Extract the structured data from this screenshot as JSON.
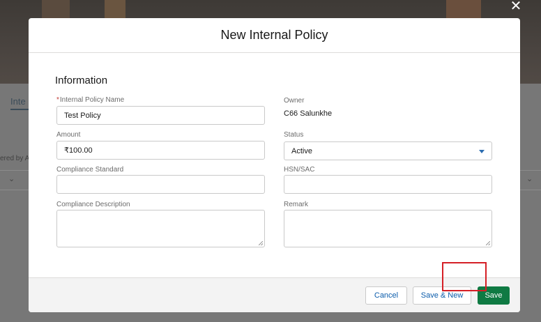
{
  "background": {
    "tab_label": "Inte",
    "filter_text": "ered by A"
  },
  "modal": {
    "title": "New Internal Policy",
    "close_icon": "close-icon",
    "section_title": "Information",
    "fields": {
      "policy_name": {
        "label": "Internal Policy Name",
        "required_marker": "*",
        "value": "Test Policy"
      },
      "owner": {
        "label": "Owner",
        "value": "C66 Salunkhe"
      },
      "amount": {
        "label": "Amount",
        "value": "₹100.00"
      },
      "status": {
        "label": "Status",
        "value": "Active"
      },
      "compliance_standard": {
        "label": "Compliance Standard",
        "value": ""
      },
      "hsn_sac": {
        "label": "HSN/SAC",
        "value": ""
      },
      "compliance_description": {
        "label": "Compliance Description",
        "value": ""
      },
      "remark": {
        "label": "Remark",
        "value": ""
      }
    },
    "footer": {
      "cancel_label": "Cancel",
      "save_new_label": "Save & New",
      "save_label": "Save"
    }
  },
  "colors": {
    "brand_button": "#0f7a43",
    "highlight": "#d51f26",
    "link_text": "#0b5cab",
    "required": "#c23934"
  }
}
